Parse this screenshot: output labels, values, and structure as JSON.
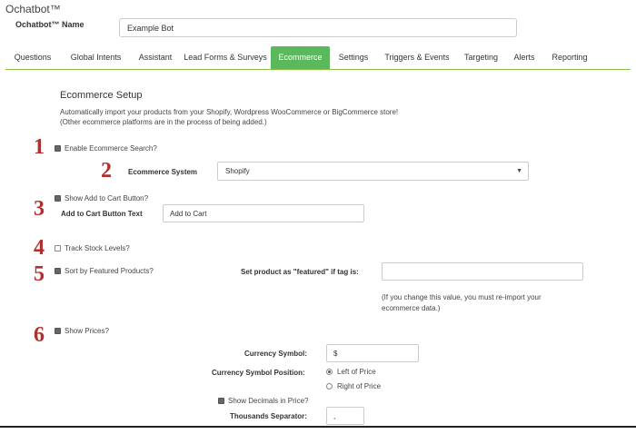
{
  "app": {
    "title": "Ochatbot™"
  },
  "bot_name": {
    "label": "Ochatbot™ Name",
    "value": "Example Bot"
  },
  "tabs": [
    {
      "label": "Questions"
    },
    {
      "label": "Global Intents"
    },
    {
      "label": "Assistant"
    },
    {
      "label": "Lead Forms & Surveys"
    },
    {
      "label": "Ecommerce"
    },
    {
      "label": "Settings"
    },
    {
      "label": "Triggers & Events"
    },
    {
      "label": "Targeting"
    },
    {
      "label": "Alerts"
    },
    {
      "label": "Reporting"
    }
  ],
  "active_tab": "Ecommerce",
  "section": {
    "title": "Ecommerce Setup",
    "description_line1": "Automatically import your products from your Shopify, Wordpress WooCommerce or BigCommerce store!",
    "description_line2": "(Other ecommerce platforms are in the process of being added.)"
  },
  "markers": [
    "1",
    "2",
    "3",
    "4",
    "5",
    "6"
  ],
  "enable_search": {
    "label": "Enable Ecommerce Search?",
    "checked": true
  },
  "ecommerce_system": {
    "label": "Ecommerce System",
    "value": "Shopify"
  },
  "add_to_cart": {
    "label": "Show Add to Cart Button?",
    "checked": true,
    "text_label": "Add to Cart Button Text",
    "text_value": "Add to Cart"
  },
  "track_stock": {
    "label": "Track Stock Levels?",
    "checked": false
  },
  "featured": {
    "label": "Sort by Featured Products?",
    "checked": true,
    "tag_label": "Set product as \"featured\" if tag is:",
    "tag_value": "",
    "note_line1": "(If you change this value, you must re-import your",
    "note_line2": "ecommerce data.)"
  },
  "prices": {
    "label": "Show Prices?",
    "checked": true,
    "currency_symbol_label": "Currency Symbol:",
    "currency_symbol_value": "$",
    "position_label": "Currency Symbol Position:",
    "position_left": "Left of Price",
    "position_right": "Right of Price",
    "position_selected": "left",
    "decimals_label": "Show Decimals in Price?",
    "decimals_checked": true,
    "thousands_label": "Thousands Separator:",
    "thousands_value": ","
  },
  "colors": {
    "accent": "#5cb85c",
    "marker": "#b03030"
  }
}
